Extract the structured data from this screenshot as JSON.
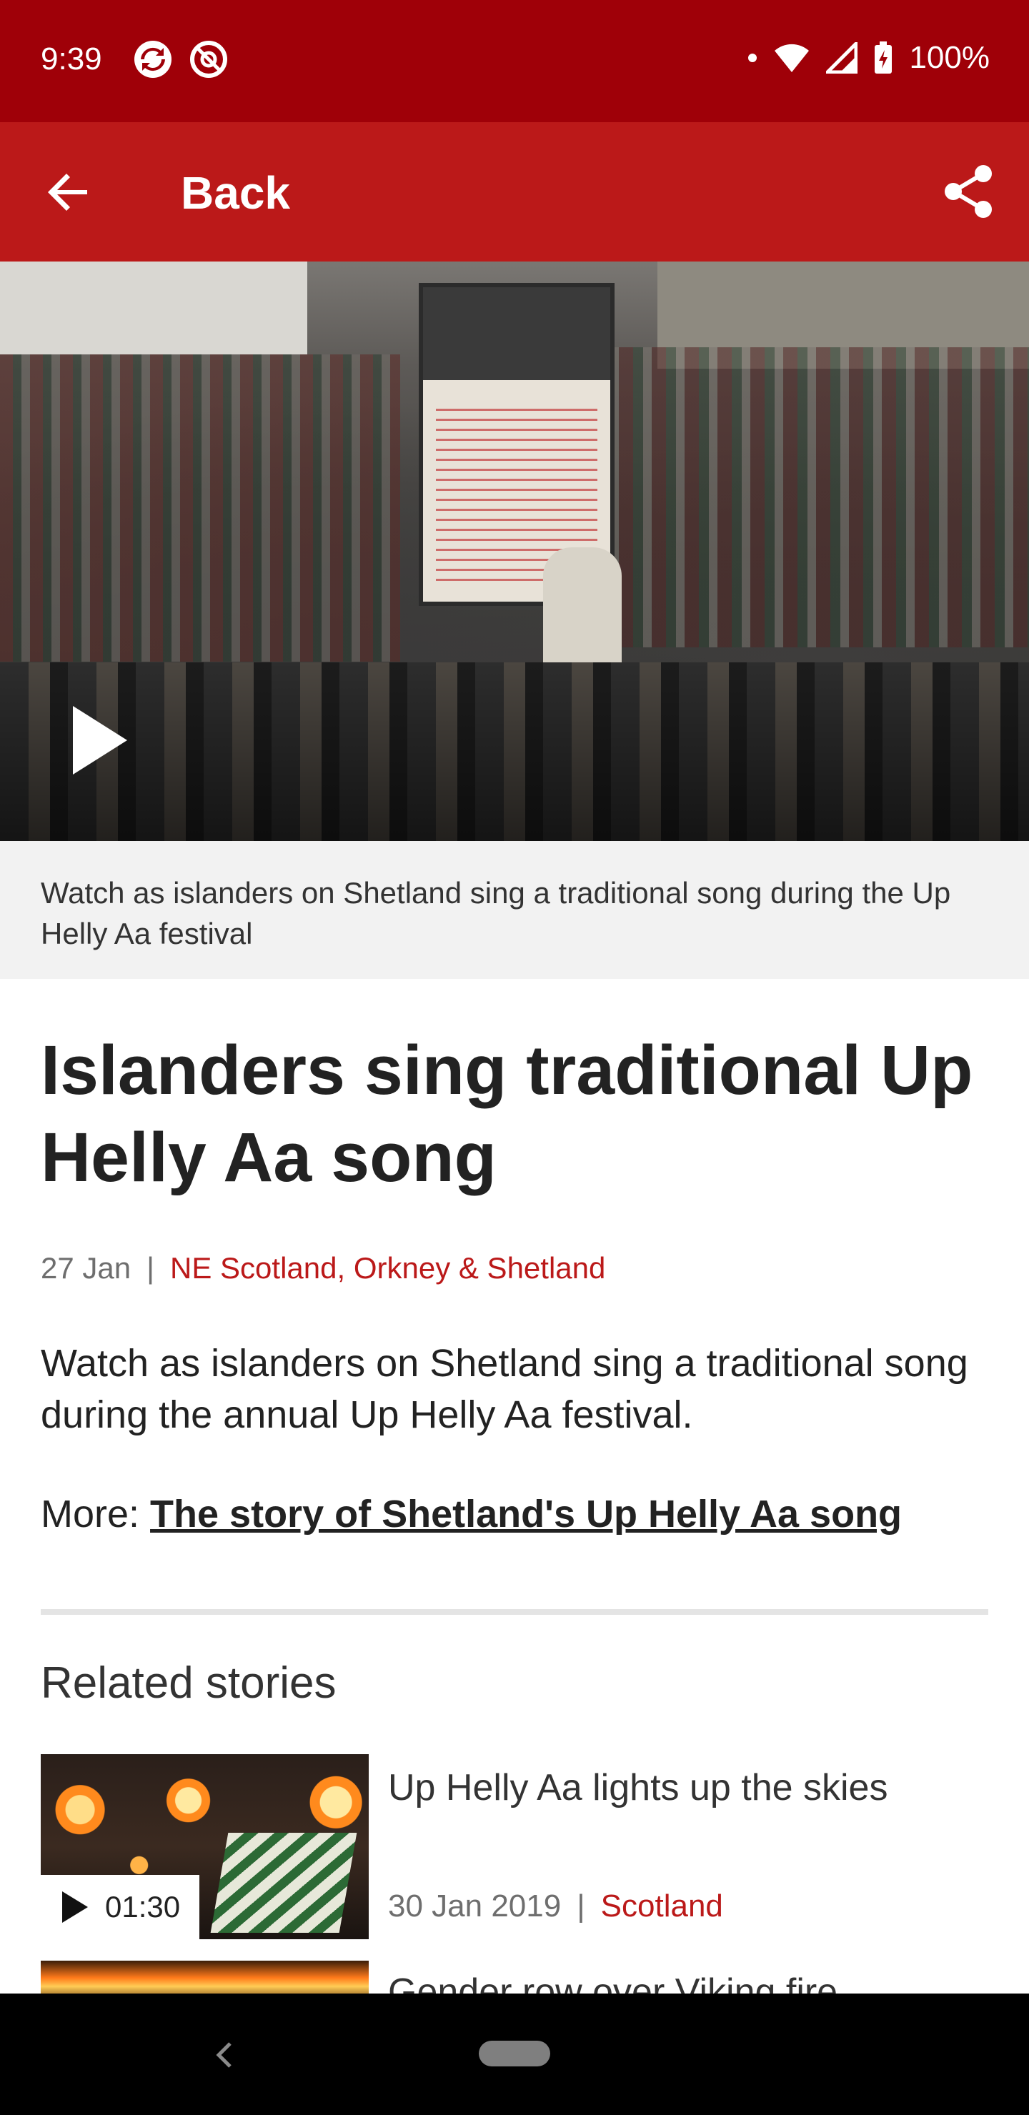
{
  "status_bar": {
    "time": "9:39",
    "battery": "100%",
    "icons": [
      "sync-icon",
      "at-sign-icon",
      "notification-dot-icon",
      "wifi-icon",
      "signal-icon",
      "battery-charging-icon"
    ]
  },
  "app_bar": {
    "back_label": "Back",
    "back_icon": "back-arrow-icon",
    "share_icon": "share-icon",
    "color": "#bb1919"
  },
  "video": {
    "caption": "Watch as islanders on Shetland sing a traditional song during the Up Helly Aa festival",
    "play_icon": "play-icon"
  },
  "article": {
    "headline": "Islanders sing traditional Up Helly Aa song",
    "date": "27 Jan",
    "separator": "|",
    "region": "NE Scotland, Orkney & Shetland",
    "summary": "Watch as islanders on Shetland sing a traditional song during the annual Up Helly Aa festival.",
    "more_prefix": "More: ",
    "more_link": "The story of Shetland's Up Helly Aa song"
  },
  "related": {
    "title": "Related stories",
    "stories": [
      {
        "title": "Up Helly Aa lights up the skies",
        "duration": "01:30",
        "date": "30 Jan 2019",
        "separator": "|",
        "region": "Scotland"
      },
      {
        "title": "Gender row over Viking fire"
      }
    ]
  },
  "nav_bar": {
    "back_icon": "nav-back-icon",
    "home_icon": "nav-home-pill"
  }
}
